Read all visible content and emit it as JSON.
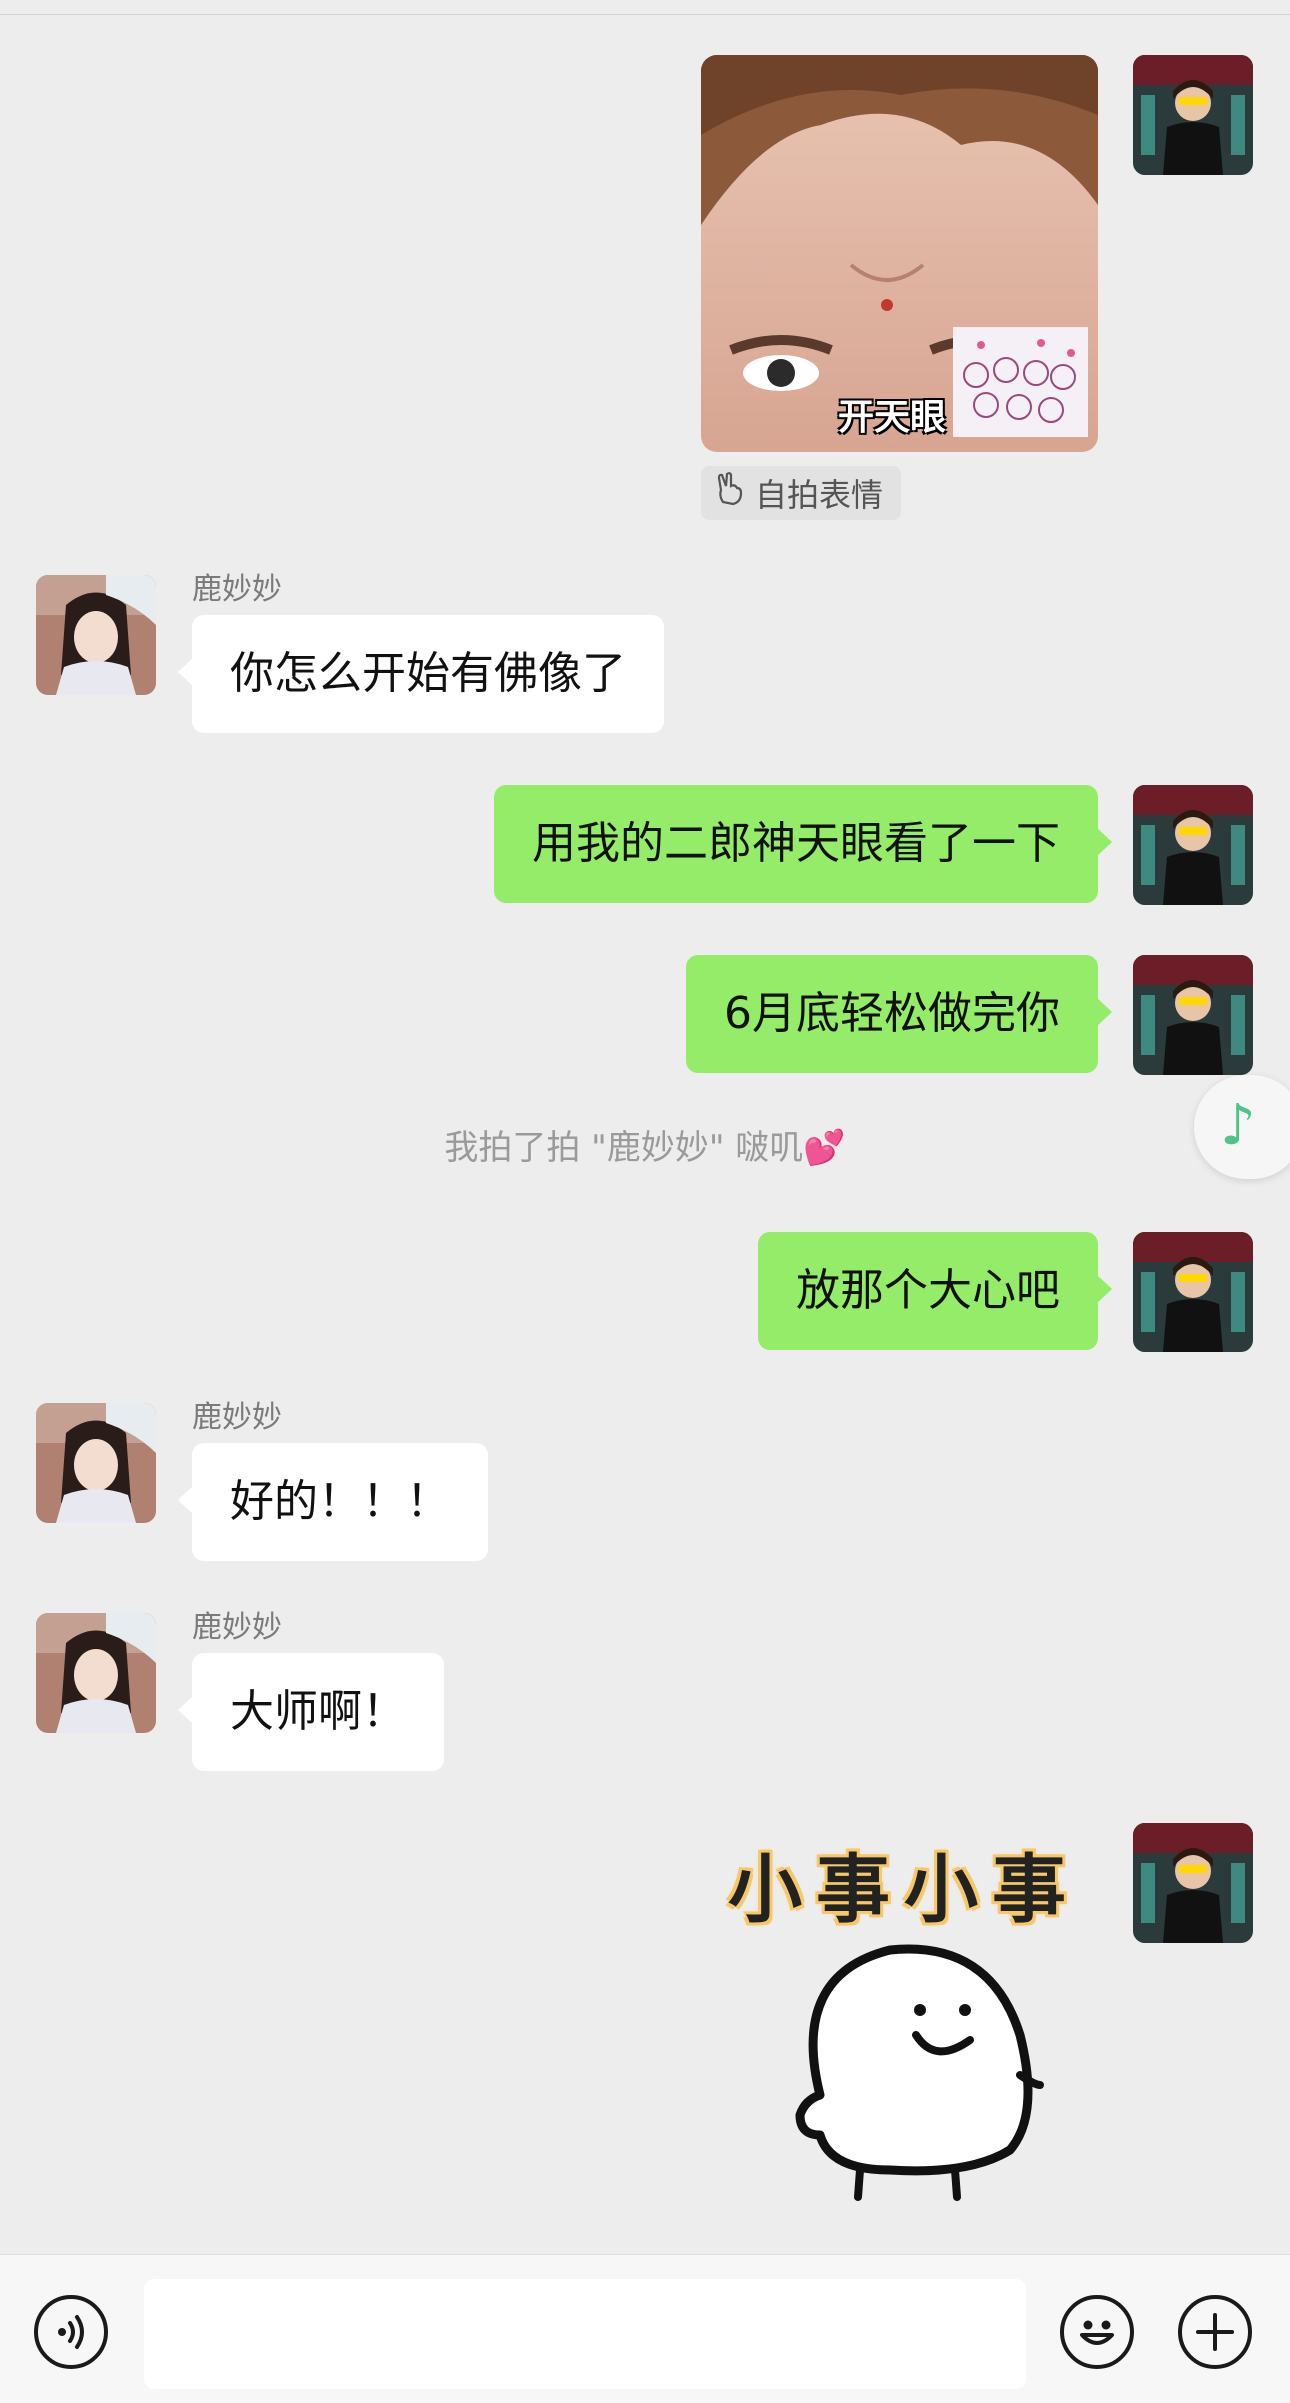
{
  "contact": {
    "name": "鹿妙妙"
  },
  "selfie_sticker": {
    "caption": "开天眼",
    "tag_label": "自拍表情",
    "tag_icon": "victory-hand-icon"
  },
  "messages": [
    {
      "side": "in",
      "sender": "鹿妙妙",
      "text": "你怎么开始有佛像了"
    },
    {
      "side": "out",
      "text": "用我的二郎神天眼看了一下"
    },
    {
      "side": "out",
      "text": "6月底轻松做完你"
    },
    {
      "side": "out",
      "text": "放那个大心吧"
    },
    {
      "side": "in",
      "sender": "鹿妙妙",
      "text": "好的！！！"
    },
    {
      "side": "in",
      "sender": "鹿妙妙",
      "text": "大师啊！"
    }
  ],
  "system_notice": {
    "text": "我拍了拍 \"鹿妙妙\" 啵叽",
    "emoji": "💕"
  },
  "floating": {
    "icon": "music-note-icon",
    "glyph": "♪",
    "color": "#4cc58a"
  },
  "final_sticker": {
    "text": "小事小事"
  },
  "input_bar": {
    "voice_icon": "voice-icon",
    "emoji_icon": "emoji-icon",
    "plus_icon": "plus-icon"
  },
  "colors": {
    "out_bubble": "#95ec69",
    "in_bubble": "#ffffff",
    "background": "#ededed"
  }
}
